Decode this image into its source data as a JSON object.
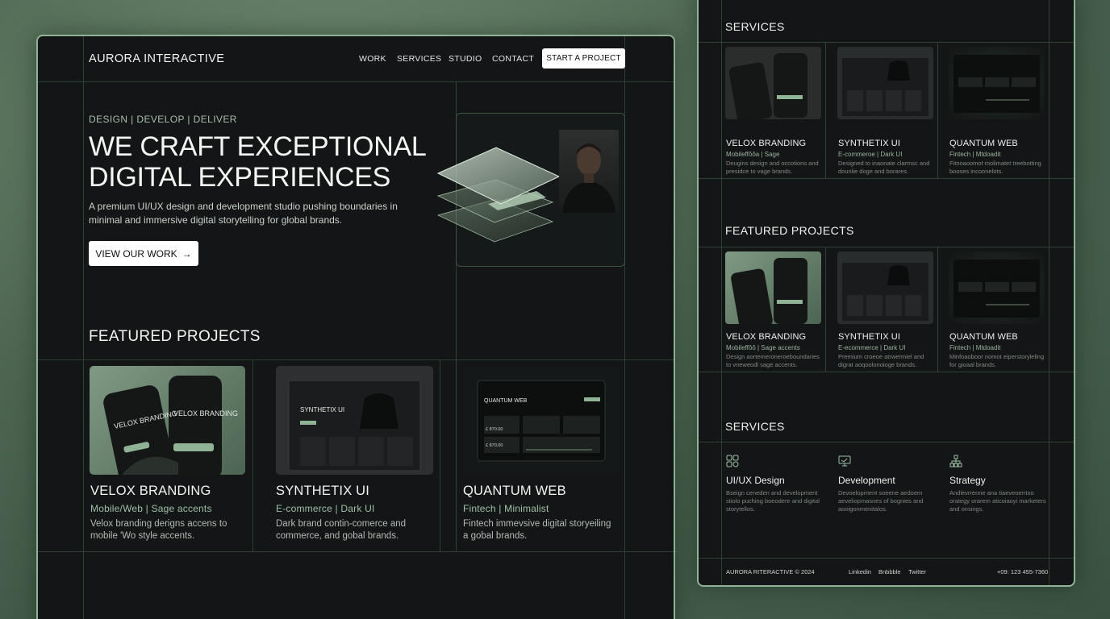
{
  "left": {
    "brand": "AURORA INTERACTIVE",
    "nav": [
      "WORK",
      "SERVICES",
      "STUDIO",
      "CONTACT"
    ],
    "cta": "START A PROJECT",
    "tagline": "DESIGN | DEVELOP | DELIVER",
    "headline_1": "WE CRAFT EXCEPTIONAL",
    "headline_2": "DIGITAL EXPERIENCES",
    "subtitle": "A premium UI/UX design and development studio pushing boundaries in minimal and immersive digital storytelling for global brands.",
    "view_button": "VIEW OUR WORK",
    "featured_title": "FEATURED PROJECTS",
    "projects": [
      {
        "title": "VELOX BRANDING",
        "meta": "Mobile/Web | Sage accents",
        "desc": "Velox branding derigns accens to mobile 'Wo style accents.",
        "img_text": "VELOX BRANDING"
      },
      {
        "title": "SYNTHETIX UI",
        "meta": "E-commerce | Dark UI",
        "desc": "Dark brand contin-comerce and commerce, and gobal brands.",
        "img_text": "SYNTHETIX UI"
      },
      {
        "title": "QUANTUM WEB",
        "meta": "Fintech | Minimalist",
        "desc": "Fintech immevsive digital storyeiling a gobal brands.",
        "img_text": "QUANTUM WEB",
        "img_values": [
          "£ 870.00",
          "£ 870.00"
        ]
      }
    ]
  },
  "right": {
    "services_title_top": "SERVICES",
    "featured_title": "FEATURED PROJECTS",
    "services_title": "SERVICES",
    "row1": [
      {
        "title": "VELOX BRANDING",
        "meta": "Mobileffôôa | Sage",
        "desc": "Deugins design and occotions and presidce to vage brands."
      },
      {
        "title": "SYNTHETIX UI",
        "meta": "E-commeroe | Dark UI",
        "desc": "Designed to inaonate clarmsc and dounlie doge and borares."
      },
      {
        "title": "QUANTUM WEB",
        "meta": "Fintech | Mtdoadit",
        "desc": "Fitnoaoomot molimatet treebotting booses incoonelots."
      }
    ],
    "row2": [
      {
        "title": "VELOX BRANDING",
        "meta": "Mobileffôô | Sage accents",
        "desc": "Design aortemeroneroeboundaries to vneweodl sage accents."
      },
      {
        "title": "SYNTHETIX UI",
        "meta": "E-ecommerce | Dark UI",
        "desc": "Premium croeoe atrwermiel and digrat aoqoolonoioge brands."
      },
      {
        "title": "QUANTUM WEB",
        "meta": "Fintech | Mtdoadit",
        "desc": "Minfoaoboor nomot eiperstoryleling for gioaal brands."
      }
    ],
    "services": [
      {
        "title": "UI/UX Design",
        "icon": "grid-icon",
        "desc": "Bseign ceneden and development stiolo puching boeodenr and digital storytellos."
      },
      {
        "title": "Development",
        "icon": "monitor-icon",
        "desc": "Devoelopment soeene aedoem aeveliopmasnes of bognies and aooigonmenitalos."
      },
      {
        "title": "Strategy",
        "icon": "hierarchy-icon",
        "desc": "Andlevrrenne ana tiaeveoerrtxo orategy orarem aticoiaoyi marketers and onsings."
      }
    ],
    "footer_brand": "AURORA RITERACTIVE © 2024",
    "footer_links": [
      "Linkedin",
      "Bnbbble",
      "Twitter"
    ],
    "footer_phone": "+09: 123 455-7360"
  }
}
